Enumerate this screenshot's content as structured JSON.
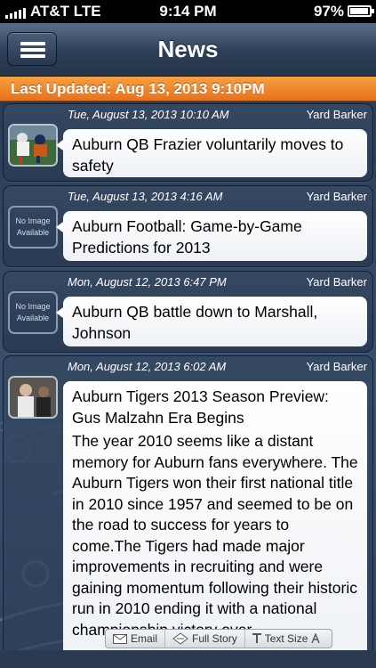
{
  "status": {
    "carrier": "AT&T  LTE",
    "time": "9:14 PM",
    "battery": "97%"
  },
  "nav": {
    "title": "News",
    "menu_icon": "hamburger-icon"
  },
  "updated": "Last Updated: Aug 13, 2013 9:10PM",
  "items": [
    {
      "date": "Tue, August 13, 2013 10:10 AM",
      "source": "Yard Barker",
      "title": "Auburn QB Frazier voluntarily moves to safety",
      "thumb": "photo"
    },
    {
      "date": "Tue, August 13, 2013 4:16 AM",
      "source": "Yard Barker",
      "title": "Auburn Football: Game-by-Game Predictions for 2013",
      "thumb_text": "No Image Available"
    },
    {
      "date": "Mon, August 12, 2013 6:47 PM",
      "source": "Yard Barker",
      "title": "Auburn QB battle down to Marshall, Johnson",
      "thumb_text": "No Image Available"
    },
    {
      "date": "Mon, August 12, 2013 6:02 AM",
      "source": "Yard Barker",
      "title": "Auburn Tigers 2013 Season Preview: Gus Malzahn Era Begins",
      "thumb": "photo",
      "story": "The year 2010 seems like a distant memory for Auburn fans everywhere. The Auburn Tigers won their first national title in 2010 since 1957 and seemed to be on the road to success for years to come.The Tigers had made major improvements in recruiting and were gaining momentum following their historic run in 2010 ending it with a national championship victory over"
    }
  ],
  "actions": {
    "email": "Email",
    "full_story": "Full Story",
    "text_size": "Text Size"
  },
  "colors": {
    "accent": "#e8711b",
    "nav": "#2d3f57"
  }
}
